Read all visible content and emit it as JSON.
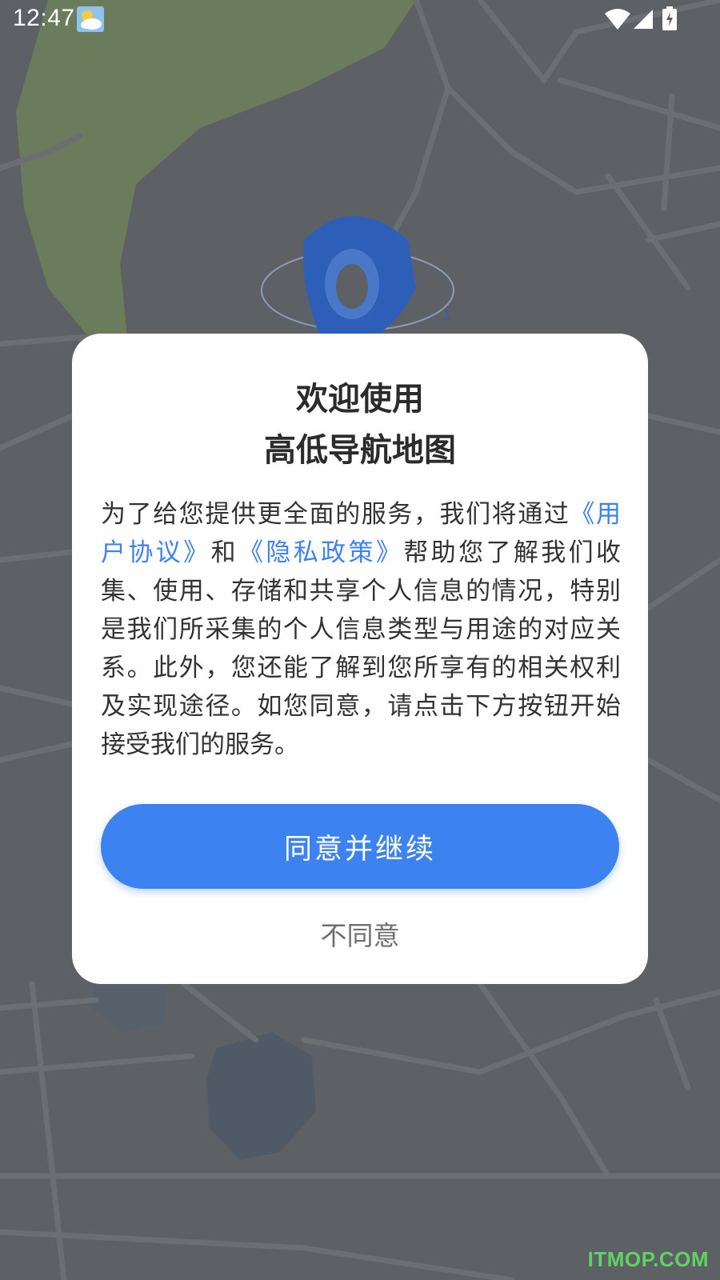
{
  "status_bar": {
    "time": "12:47",
    "weather_icon": "partly-cloudy-icon",
    "wifi_icon": "wifi-icon",
    "signal_icon": "cell-signal-icon",
    "battery_icon": "battery-charging-icon"
  },
  "dialog": {
    "title_line1": "欢迎使用",
    "title_line2": "高低导航地图",
    "body_part1": "为了给您提供更全面的服务，我们将通过",
    "user_agreement_link": "《用户协议》",
    "body_and": "和",
    "privacy_policy_link": "《隐私政策》",
    "body_part2": "帮助您了解我们收集、使用、存储和共享个人信息的情况，特别是我们所采集的个人信息类型与用途的对应关系。此外，您还能了解到您所享有的相关权利及实现途径。如您同意，请点击下方按钮开始接受我们的服务。",
    "agree_label": "同意并继续",
    "disagree_label": "不同意"
  },
  "watermark": "ITMOP.COM",
  "colors": {
    "accent": "#3d82f1",
    "overlay_map": "#5c6064",
    "watermark": "#5fd35f"
  }
}
